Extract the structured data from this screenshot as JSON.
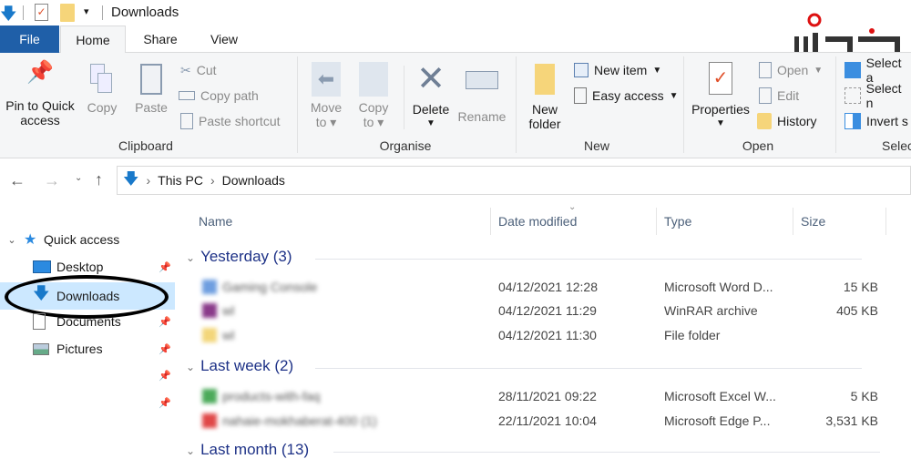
{
  "title_bar": {
    "title": "Downloads"
  },
  "tabs": [
    {
      "label": "File"
    },
    {
      "label": "Home"
    },
    {
      "label": "Share"
    },
    {
      "label": "View"
    }
  ],
  "ribbon": {
    "clipboard": {
      "label": "Clipboard",
      "pin": "Pin to Quick access",
      "pin1": "Pin to Quick",
      "pin2": "access",
      "copy": "Copy",
      "paste": "Paste",
      "cut": "Cut",
      "copy_path": "Copy path",
      "paste_shortcut": "Paste shortcut"
    },
    "organise": {
      "label": "Organise",
      "move1": "Move",
      "move2": "to",
      "copy1": "Copy",
      "copy2": "to",
      "delete": "Delete",
      "rename": "Rename"
    },
    "new": {
      "label": "New",
      "new_folder1": "New",
      "new_folder2": "folder",
      "new_item": "New item",
      "easy_access": "Easy access"
    },
    "open": {
      "label": "Open",
      "properties": "Properties",
      "open": "Open",
      "edit": "Edit",
      "history": "History"
    },
    "select": {
      "label": "Selec",
      "select_all": "Select a",
      "select_none": "Select n",
      "invert": "Invert s"
    }
  },
  "address": {
    "crumbs": [
      "This PC",
      "Downloads"
    ]
  },
  "nav": {
    "quick_access": "Quick access",
    "items": [
      {
        "label": "Desktop"
      },
      {
        "label": "Downloads"
      },
      {
        "label": "Documents"
      },
      {
        "label": "Pictures"
      }
    ]
  },
  "columns": {
    "name": "Name",
    "date": "Date modified",
    "type": "Type",
    "size": "Size"
  },
  "groups": [
    {
      "label": "Yesterday (3)",
      "files": [
        {
          "name": "Gaming Console",
          "date": "04/12/2021 12:28",
          "type": "Microsoft Word D...",
          "size": "15 KB",
          "color": "#6f9ee0"
        },
        {
          "name": "wl",
          "date": "04/12/2021 11:29",
          "type": "WinRAR archive",
          "size": "405 KB",
          "color": "#8a3a8a"
        },
        {
          "name": "wl",
          "date": "04/12/2021 11:30",
          "type": "File folder",
          "size": "",
          "color": "#f3d67a"
        }
      ]
    },
    {
      "label": "Last week (2)",
      "files": [
        {
          "name": "products-with-faq",
          "date": "28/11/2021 09:22",
          "type": "Microsoft Excel W...",
          "size": "5 KB",
          "color": "#4caa5a"
        },
        {
          "name": "nahaie-mokhaberat-400 (1)",
          "date": "22/11/2021 10:04",
          "type": "Microsoft Edge P...",
          "size": "3,531 KB",
          "color": "#e04848"
        }
      ]
    },
    {
      "label": "Last month (13)",
      "files": []
    }
  ],
  "colors": {
    "accent": "#1979ca",
    "file_tab": "#1f5fa8",
    "selection": "#cce8ff",
    "group_text": "#1e3287"
  }
}
